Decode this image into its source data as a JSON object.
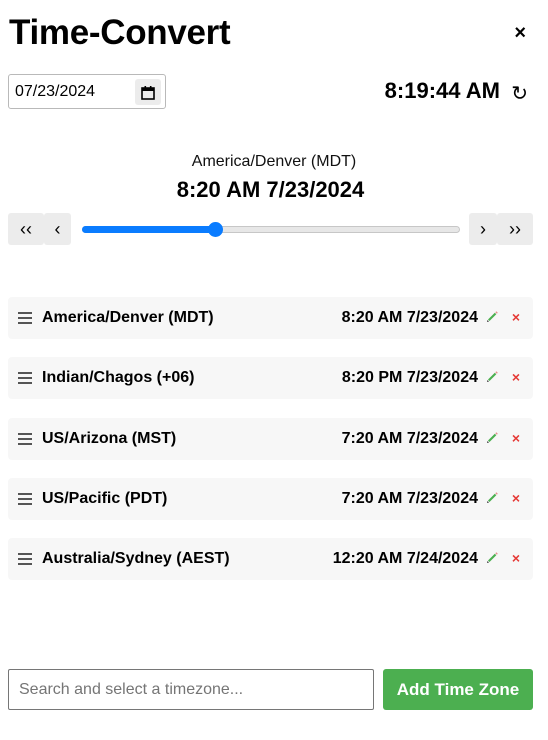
{
  "app": {
    "title": "Time-Convert",
    "close_label": "×"
  },
  "date_picker": {
    "value": "07/23/2024"
  },
  "clock": {
    "current_time": "8:19:44 AM",
    "refresh_label": "↻"
  },
  "selected": {
    "zone": "America/Denver (MDT)",
    "time": "8:20 AM 7/23/2024"
  },
  "slider": {
    "prev_fast_label": "‹‹",
    "prev_label": "‹",
    "next_label": "›",
    "next_fast_label": "››",
    "value_fraction": 0.35
  },
  "timezones": [
    {
      "zone": "America/Denver (MDT)",
      "time": "8:20 AM 7/23/2024"
    },
    {
      "zone": "Indian/Chagos (+06)",
      "time": "8:20 PM 7/23/2024"
    },
    {
      "zone": "US/Arizona (MST)",
      "time": "7:20 AM 7/23/2024"
    },
    {
      "zone": "US/Pacific (PDT)",
      "time": "7:20 AM 7/23/2024"
    },
    {
      "zone": "Australia/Sydney (AEST)",
      "time": "12:20 AM 7/24/2024"
    }
  ],
  "row_icons": {
    "edit": "pencil-icon",
    "delete": "close-icon",
    "delete_glyph": "×",
    "drag": "drag-handle-icon"
  },
  "search": {
    "placeholder": "Search and select a timezone..."
  },
  "add_button": {
    "label": "Add Time Zone"
  },
  "colors": {
    "accent": "#0a7cff",
    "add_button": "#4caf50",
    "delete": "#e53935",
    "edit": "#4caf50"
  }
}
